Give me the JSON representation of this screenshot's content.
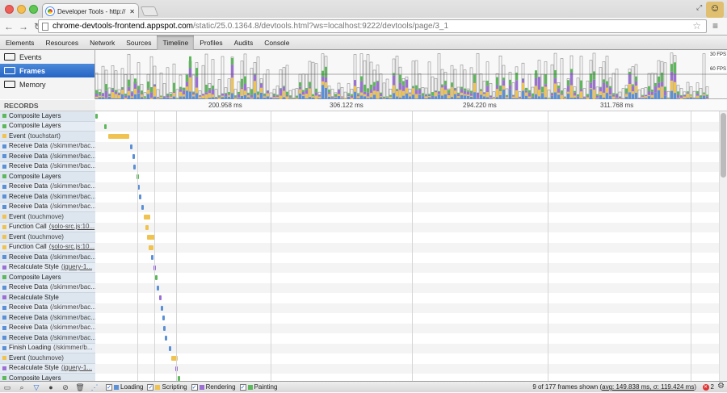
{
  "browser": {
    "tab_title": "Developer Tools - http://",
    "url_host": "chrome-devtools-frontend.appspot.com",
    "url_path": "/static/25.0.1364.8/devtools.html?ws=localhost:9222/devtools/page/3_1"
  },
  "devtools_tabs": [
    "Elements",
    "Resources",
    "Network",
    "Sources",
    "Timeline",
    "Profiles",
    "Audits",
    "Console"
  ],
  "active_tab": "Timeline",
  "modes": [
    {
      "label": "Events",
      "selected": false
    },
    {
      "label": "Frames",
      "selected": true
    },
    {
      "label": "Memory",
      "selected": false
    }
  ],
  "overview": {
    "fps30": "30 FPS",
    "fps60": "60 FPS"
  },
  "records_header": "RECORDS",
  "ticks": [
    "200.958 ms",
    "306.122 ms",
    "294.220 ms",
    "311.768 ms"
  ],
  "colors": {
    "loading": "#5b8fd6",
    "scripting": "#f0c24f",
    "rendering": "#9b6fd6",
    "painting": "#5db85b"
  },
  "records": [
    {
      "cat": "painting",
      "label": "Composite Layers",
      "sub": ""
    },
    {
      "cat": "painting",
      "label": "Composite Layers",
      "sub": ""
    },
    {
      "cat": "scripting",
      "label": "Event",
      "sub": "(touchstart)"
    },
    {
      "cat": "loading",
      "label": "Receive Data",
      "sub": "(/skimmer/bac..."
    },
    {
      "cat": "loading",
      "label": "Receive Data",
      "sub": "(/skimmer/bac..."
    },
    {
      "cat": "loading",
      "label": "Receive Data",
      "sub": "(/skimmer/bac..."
    },
    {
      "cat": "painting",
      "label": "Composite Layers",
      "sub": ""
    },
    {
      "cat": "loading",
      "label": "Receive Data",
      "sub": "(/skimmer/bac..."
    },
    {
      "cat": "loading",
      "label": "Receive Data",
      "sub": "(/skimmer/bac..."
    },
    {
      "cat": "loading",
      "label": "Receive Data",
      "sub": "(/skimmer/bac..."
    },
    {
      "cat": "scripting",
      "label": "Event",
      "sub": "(touchmove)"
    },
    {
      "cat": "scripting",
      "label": "Function Call",
      "sub": "(solo-src.js:10...",
      "link": true
    },
    {
      "cat": "scripting",
      "label": "Event",
      "sub": "(touchmove)"
    },
    {
      "cat": "scripting",
      "label": "Function Call",
      "sub": "(solo-src.js:10...",
      "link": true
    },
    {
      "cat": "loading",
      "label": "Receive Data",
      "sub": "(/skimmer/bac..."
    },
    {
      "cat": "rendering",
      "label": "Recalculate Style",
      "sub": "(jquery-1...",
      "link": true
    },
    {
      "cat": "painting",
      "label": "Composite Layers",
      "sub": ""
    },
    {
      "cat": "loading",
      "label": "Receive Data",
      "sub": "(/skimmer/bac..."
    },
    {
      "cat": "rendering",
      "label": "Recalculate Style",
      "sub": ""
    },
    {
      "cat": "loading",
      "label": "Receive Data",
      "sub": "(/skimmer/bac..."
    },
    {
      "cat": "loading",
      "label": "Receive Data",
      "sub": "(/skimmer/bac..."
    },
    {
      "cat": "loading",
      "label": "Receive Data",
      "sub": "(/skimmer/bac..."
    },
    {
      "cat": "loading",
      "label": "Receive Data",
      "sub": "(/skimmer/bac..."
    },
    {
      "cat": "loading",
      "label": "Finish Loading",
      "sub": "(/skimmer/b..."
    },
    {
      "cat": "scripting",
      "label": "Event",
      "sub": "(touchmove)"
    },
    {
      "cat": "rendering",
      "label": "Recalculate Style",
      "sub": "(jquery-1...",
      "link": true
    },
    {
      "cat": "painting",
      "label": "Composite Layers",
      "sub": ""
    }
  ],
  "legend": [
    {
      "label": "Loading",
      "cat": "loading"
    },
    {
      "label": "Scripting",
      "cat": "scripting"
    },
    {
      "label": "Rendering",
      "cat": "rendering"
    },
    {
      "label": "Painting",
      "cat": "painting"
    }
  ],
  "status": {
    "frames_prefix": "9 of 177 frames shown (",
    "frames_stats": "avg: 149.838 ms, σ: 119.424 ms",
    "frames_suffix": ")",
    "error_count": "2"
  }
}
